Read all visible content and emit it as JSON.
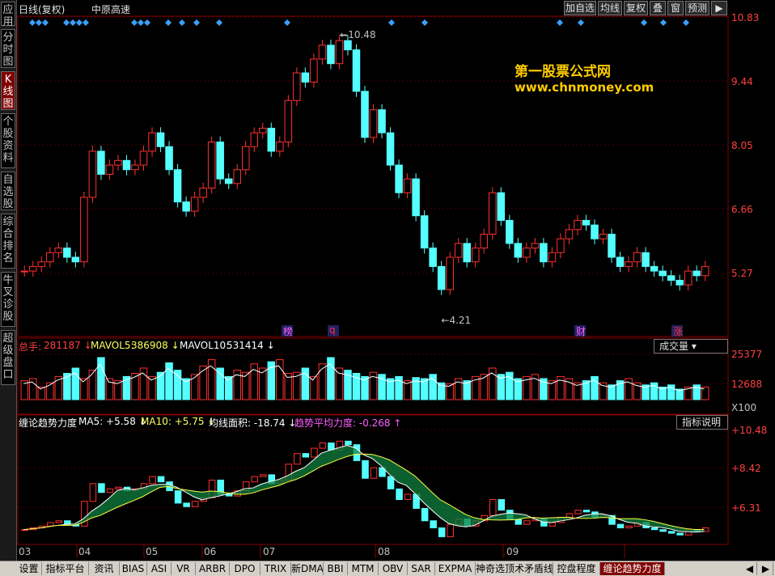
{
  "sidebar": [
    "应用",
    "分时图",
    "K线图",
    "个股资料",
    "自选股",
    "综合排名",
    "牛叉诊股",
    "超级盘口"
  ],
  "topbar": {
    "title": "日线(复权)",
    "stock": "中原高速",
    "buttons": [
      "加自选",
      "均线",
      "复权",
      "叠",
      "窗",
      "预测"
    ],
    "arrow": "▶"
  },
  "watermark": {
    "line1": "第一股票公式网",
    "line2": "www.chnmoney.com"
  },
  "price_axis": [
    "10.83",
    "9.44",
    "8.05",
    "6.66",
    "5.27"
  ],
  "price_marks": {
    "high": "10.48",
    "low": "4.21"
  },
  "event_labels": [
    "榜",
    "q",
    "财",
    "涨"
  ],
  "volume_panel": {
    "label": "总手:",
    "value": "281187",
    "ma5_label": "MAVOL5:",
    "ma5": "386908",
    "ma10_label": "MAVOL10:",
    "ma10": "531414",
    "selector": "成交量",
    "axis": [
      "25377",
      "12688",
      "X100"
    ]
  },
  "indicator_panel": {
    "name": "缠论趋势力度",
    "ma5": "MA5: +5.58",
    "ma10": "MA10: +5.75",
    "area": "均线面积: -18.74",
    "avg": "趋势平均力度: -0.268",
    "help": "指标说明",
    "axis": [
      "+10.48",
      "+8.42",
      "+6.31"
    ]
  },
  "months": [
    "03",
    "04",
    "05",
    "06",
    "07",
    "08",
    "09"
  ],
  "bottom_tabs": [
    "设置",
    "指标平台",
    "资讯",
    "BIAS",
    "ASI",
    "VR",
    "ARBR",
    "DPO",
    "TRIX",
    "新DMA",
    "BBI",
    "MTM",
    "OBV",
    "SAR",
    "EXPMA",
    "神奇选顶术矛盾线",
    "控盘程度",
    "缠论趋势力度"
  ],
  "chart_data": {
    "type": "candlestick",
    "price_range": [
      3.88,
      10.83
    ],
    "x_months": [
      "03",
      "04",
      "05",
      "06",
      "07",
      "08",
      "09"
    ],
    "high": 10.48,
    "low": 4.21,
    "closes": [
      5.3,
      5.4,
      5.5,
      5.7,
      5.8,
      5.6,
      5.5,
      6.9,
      7.9,
      7.4,
      7.6,
      7.7,
      7.5,
      7.6,
      7.9,
      8.3,
      8.0,
      7.5,
      6.8,
      6.6,
      6.9,
      7.1,
      8.1,
      7.3,
      7.2,
      7.5,
      8.0,
      8.3,
      8.4,
      7.9,
      8.1,
      9.0,
      9.6,
      9.4,
      9.9,
      10.2,
      9.8,
      10.3,
      10.1,
      9.2,
      8.2,
      8.8,
      8.3,
      7.6,
      7.0,
      7.3,
      6.5,
      5.8,
      5.4,
      4.9,
      5.6,
      5.9,
      5.5,
      5.8,
      6.1,
      7.0,
      6.4,
      5.9,
      5.6,
      5.8,
      5.9,
      5.5,
      5.7,
      6.0,
      6.2,
      6.4,
      6.3,
      6.0,
      6.1,
      5.6,
      5.4,
      5.5,
      5.7,
      5.4,
      5.3,
      5.2,
      5.1,
      5.0,
      5.3,
      5.2,
      5.4
    ]
  }
}
